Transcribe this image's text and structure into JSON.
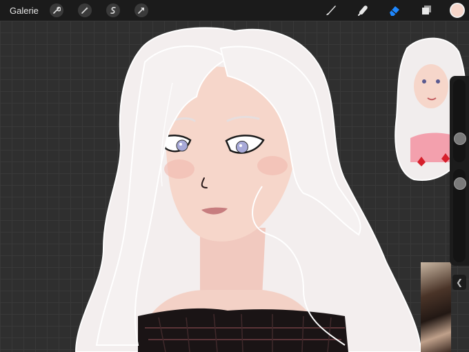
{
  "toolbar": {
    "gallery_label": "Galerie",
    "left_tools": [
      {
        "name": "wrench-icon"
      },
      {
        "name": "magic-wand-icon"
      },
      {
        "name": "selection-icon"
      },
      {
        "name": "transform-arrow-icon"
      }
    ],
    "right_tools": [
      {
        "name": "brush-icon"
      },
      {
        "name": "smudge-icon"
      },
      {
        "name": "eraser-icon",
        "active": true
      },
      {
        "name": "layers-icon"
      }
    ],
    "current_color": "#f6d6ca",
    "active_tool_color": "#1e88ff"
  }
}
